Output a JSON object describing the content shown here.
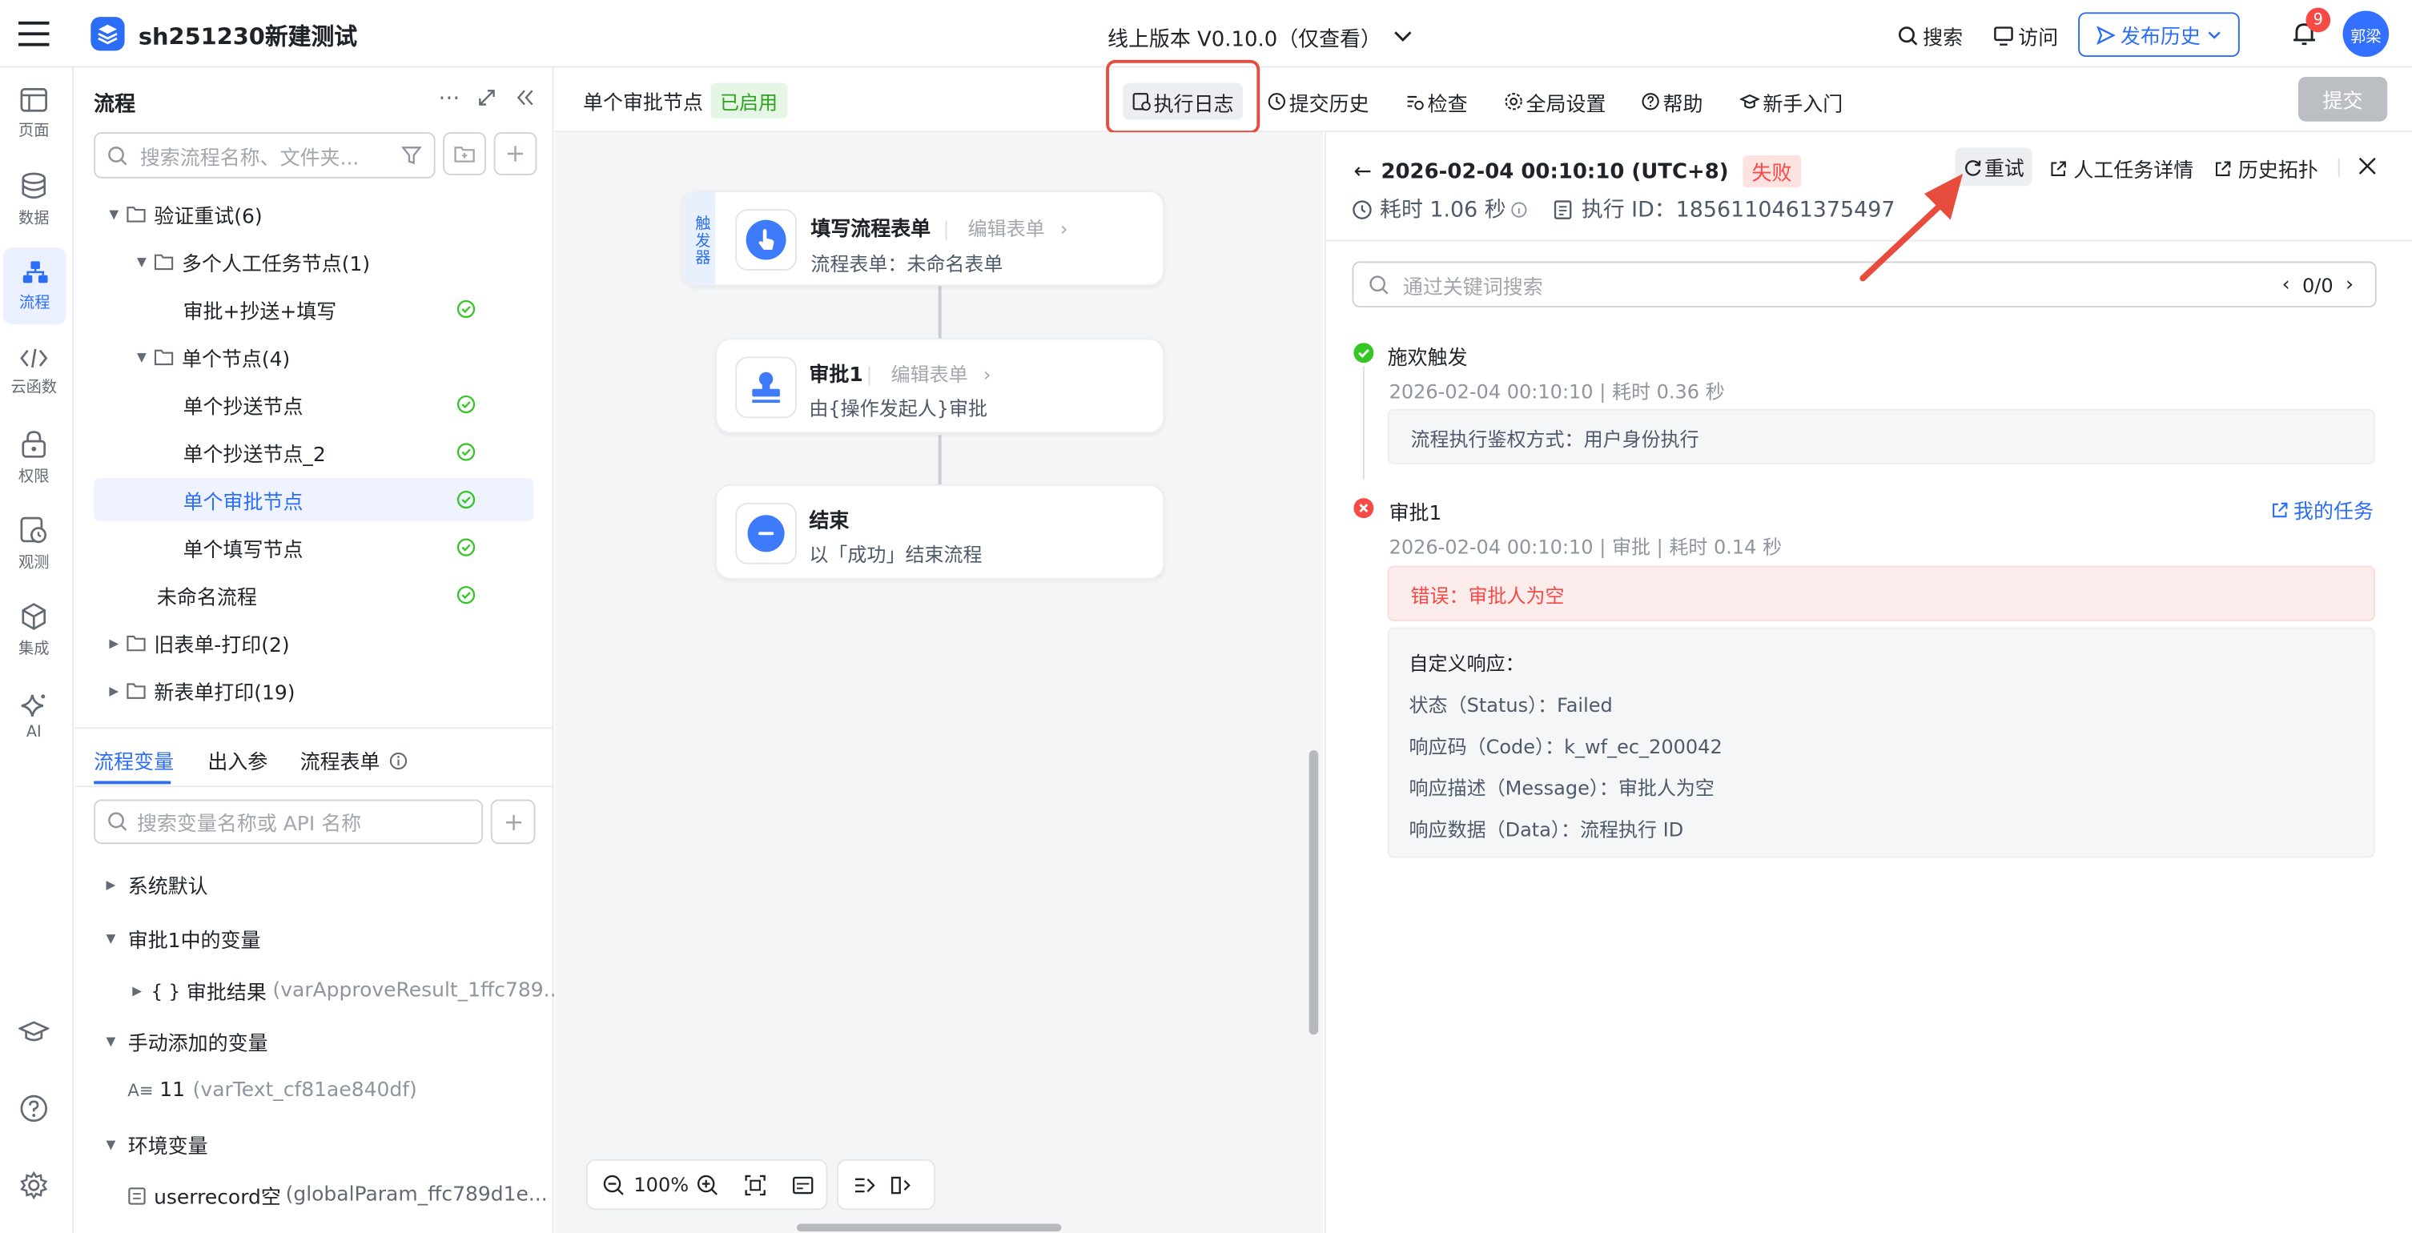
{
  "app": {
    "title": "sh251230新建测试",
    "version": "线上版本 V0.10.0（仅查看）",
    "search": "搜索",
    "visit": "访问",
    "publish_history": "发布历史",
    "notification_count": "9",
    "avatar": "郭梁",
    "brand_color": "#2b6df6"
  },
  "nav": [
    {
      "label": "页面",
      "icon": "page-icon"
    },
    {
      "label": "数据",
      "icon": "database-icon"
    },
    {
      "label": "流程",
      "icon": "flow-icon"
    },
    {
      "label": "云函数",
      "icon": "code-icon"
    },
    {
      "label": "权限",
      "icon": "lock-icon"
    },
    {
      "label": "观测",
      "icon": "monitor-icon"
    },
    {
      "label": "集成",
      "icon": "cube-icon"
    },
    {
      "label": "AI",
      "icon": "sparkle-icon"
    }
  ],
  "flows": {
    "title": "流程",
    "search_placeholder": "搜索流程名称、文件夹...",
    "tree": [
      {
        "label": "验证重试(6)"
      },
      {
        "label": "多个人工任务节点(1)"
      },
      {
        "label": "审批+抄送+填写"
      },
      {
        "label": "单个节点(4)"
      },
      {
        "label": "单个抄送节点"
      },
      {
        "label": "单个抄送节点_2"
      },
      {
        "label": "单个审批节点"
      },
      {
        "label": "单个填写节点"
      },
      {
        "label": "未命名流程"
      },
      {
        "label": "旧表单-打印(2)"
      },
      {
        "label": "新表单打印(19)"
      }
    ]
  },
  "vars": {
    "tabs": [
      "流程变量",
      "出入参",
      "流程表单"
    ],
    "search_placeholder": "搜索变量名称或 API 名称",
    "groups": [
      {
        "label": "系统默认"
      },
      {
        "label": "审批1中的变量"
      },
      {
        "label": "审批结果",
        "api": "(varApproveResult_1ffc789..."
      },
      {
        "label": "手动添加的变量"
      },
      {
        "label": "11",
        "api": "(varText_cf81ae840df)"
      },
      {
        "label": "环境变量"
      },
      {
        "label": "userrecord空",
        "api": "(globalParam_ffc789d1e..."
      }
    ]
  },
  "toolbar": {
    "node_name": "单个审批节点",
    "status": "已启用",
    "buttons": [
      "执行日志",
      "提交历史",
      "检查",
      "全局设置",
      "帮助",
      "新手入门"
    ],
    "submit": "提交"
  },
  "canvas": {
    "trigger_label": "触发器",
    "nodes": [
      {
        "title": "填写流程表单",
        "link": "编辑表单",
        "sub": "流程表单：未命名表单"
      },
      {
        "title": "审批1",
        "link": "编辑表单",
        "sub": "由{操作发起人}审批"
      },
      {
        "title": "结束",
        "link": "",
        "sub": "以「成功」结束流程"
      }
    ],
    "zoom": "100%"
  },
  "log": {
    "time": "2026-02-04 00:10:10 (UTC+8)",
    "status": "失败",
    "retry": "重试",
    "task_detail": "人工任务详情",
    "history_topo": "历史拓扑",
    "duration": "耗时 1.06 秒",
    "exec_id": "执行 ID：1856110461375497",
    "search_placeholder": "通过关键词搜索",
    "search_count": "0/0",
    "entries": [
      {
        "title": "施欢触发",
        "meta": "2026-02-04 00:10:10 | 耗时 0.36 秒",
        "detail": "流程执行鉴权方式：用户身份执行"
      },
      {
        "title": "审批1",
        "meta": "2026-02-04 00:10:10 | 审批 | 耗时 0.14 秒",
        "my_task": "我的任务",
        "error": "错误：审批人为空",
        "response_title": "自定义响应：",
        "response": [
          "状态（Status）：Failed",
          "响应码（Code）：k_wf_ec_200042",
          "响应描述（Message）：审批人为空",
          "响应数据（Data）：流程执行 ID"
        ]
      }
    ]
  }
}
